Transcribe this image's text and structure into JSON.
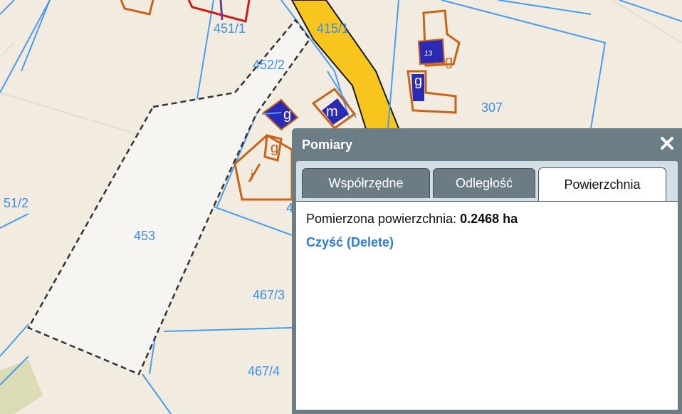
{
  "map": {
    "parcel_labels": [
      "451/1",
      "415/1",
      "452/2",
      "307",
      "51/2",
      "453",
      "4",
      "467/3",
      "467/4"
    ],
    "building_labels": [
      "13",
      "g",
      "g",
      "g",
      "m",
      "g",
      "i"
    ]
  },
  "panel": {
    "title": "Pomiary",
    "close_icon": "close-icon",
    "tabs": [
      {
        "label": "Współrzędne",
        "active": false
      },
      {
        "label": "Odległość",
        "active": false
      },
      {
        "label": "Powierzchnia",
        "active": true
      }
    ],
    "measurement_label": "Pomierzona powierzchnia: ",
    "measurement_value": "0.2468 ha",
    "clear_link": "Czyść (Delete)"
  },
  "colors": {
    "map_background": "#f1ebe0",
    "parcel_line": "#4a9cf0",
    "building_outline": "#c8641a",
    "road": "#f8c51f",
    "building_fill": "#2a2ab5",
    "panel_header": "#6d7d86",
    "link": "#2f7cd6"
  }
}
